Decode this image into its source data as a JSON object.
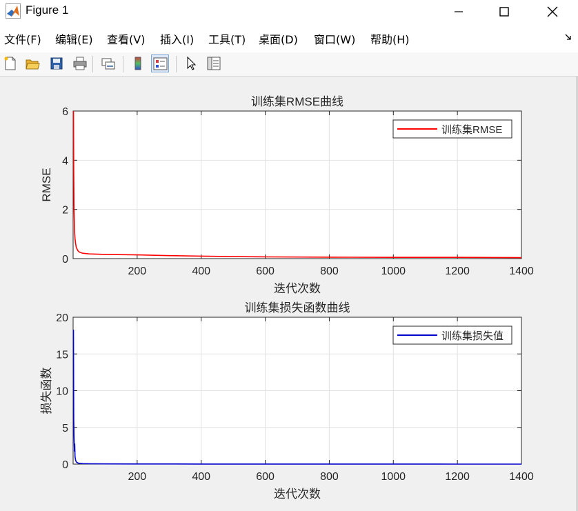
{
  "window": {
    "title": "Figure 1"
  },
  "menu": {
    "items": [
      "文件(F)",
      "编辑(E)",
      "查看(V)",
      "插入(I)",
      "工具(T)",
      "桌面(D)",
      "窗口(W)",
      "帮助(H)"
    ]
  },
  "toolbar": {
    "buttons": [
      "new-figure",
      "open-file",
      "save",
      "print",
      "link-plot",
      "colorbar",
      "legend",
      "edit-plot",
      "property-inspector"
    ]
  },
  "colors": {
    "rmse_line": "#ff0000",
    "loss_line": "#0000cc"
  },
  "chart_data": [
    {
      "type": "line",
      "title": "训练集RMSE曲线",
      "xlabel": "迭代次数",
      "ylabel": "RMSE",
      "xlim": [
        0,
        1400
      ],
      "ylim": [
        0,
        6
      ],
      "xticks": [
        200,
        400,
        600,
        800,
        1000,
        1200,
        1400
      ],
      "yticks": [
        0,
        2,
        4,
        6
      ],
      "grid": true,
      "legend_position": "top-right",
      "series": [
        {
          "name": "训练集RMSE",
          "color": "#ff0000",
          "x": [
            1,
            2,
            3,
            4,
            5,
            6,
            8,
            10,
            15,
            20,
            30,
            50,
            100,
            200,
            300,
            400,
            500,
            600,
            800,
            1000,
            1200,
            1400
          ],
          "y": [
            6.0,
            3.5,
            2.0,
            1.3,
            1.0,
            0.8,
            0.6,
            0.45,
            0.32,
            0.26,
            0.22,
            0.19,
            0.17,
            0.15,
            0.12,
            0.1,
            0.08,
            0.07,
            0.06,
            0.05,
            0.05,
            0.04
          ]
        }
      ]
    },
    {
      "type": "line",
      "title": "训练集损失函数曲线",
      "xlabel": "迭代次数",
      "ylabel": "损失函数",
      "xlim": [
        0,
        1400
      ],
      "ylim": [
        0,
        20
      ],
      "xticks": [
        200,
        400,
        600,
        800,
        1000,
        1200,
        1400
      ],
      "yticks": [
        0,
        5,
        10,
        15,
        20
      ],
      "grid": true,
      "legend_position": "top-right",
      "series": [
        {
          "name": "训练集损失值",
          "color": "#0000cc",
          "x": [
            1,
            2,
            3,
            4,
            5,
            6,
            8,
            10,
            15,
            20,
            30,
            50,
            100,
            200,
            400,
            600,
            800,
            1000,
            1200,
            1400
          ],
          "y": [
            18.3,
            6.0,
            3.5,
            1.7,
            2.8,
            1.0,
            0.5,
            0.3,
            0.15,
            0.1,
            0.07,
            0.05,
            0.03,
            0.02,
            0.01,
            0.01,
            0.005,
            0.005,
            0.004,
            0.003
          ]
        }
      ]
    }
  ]
}
